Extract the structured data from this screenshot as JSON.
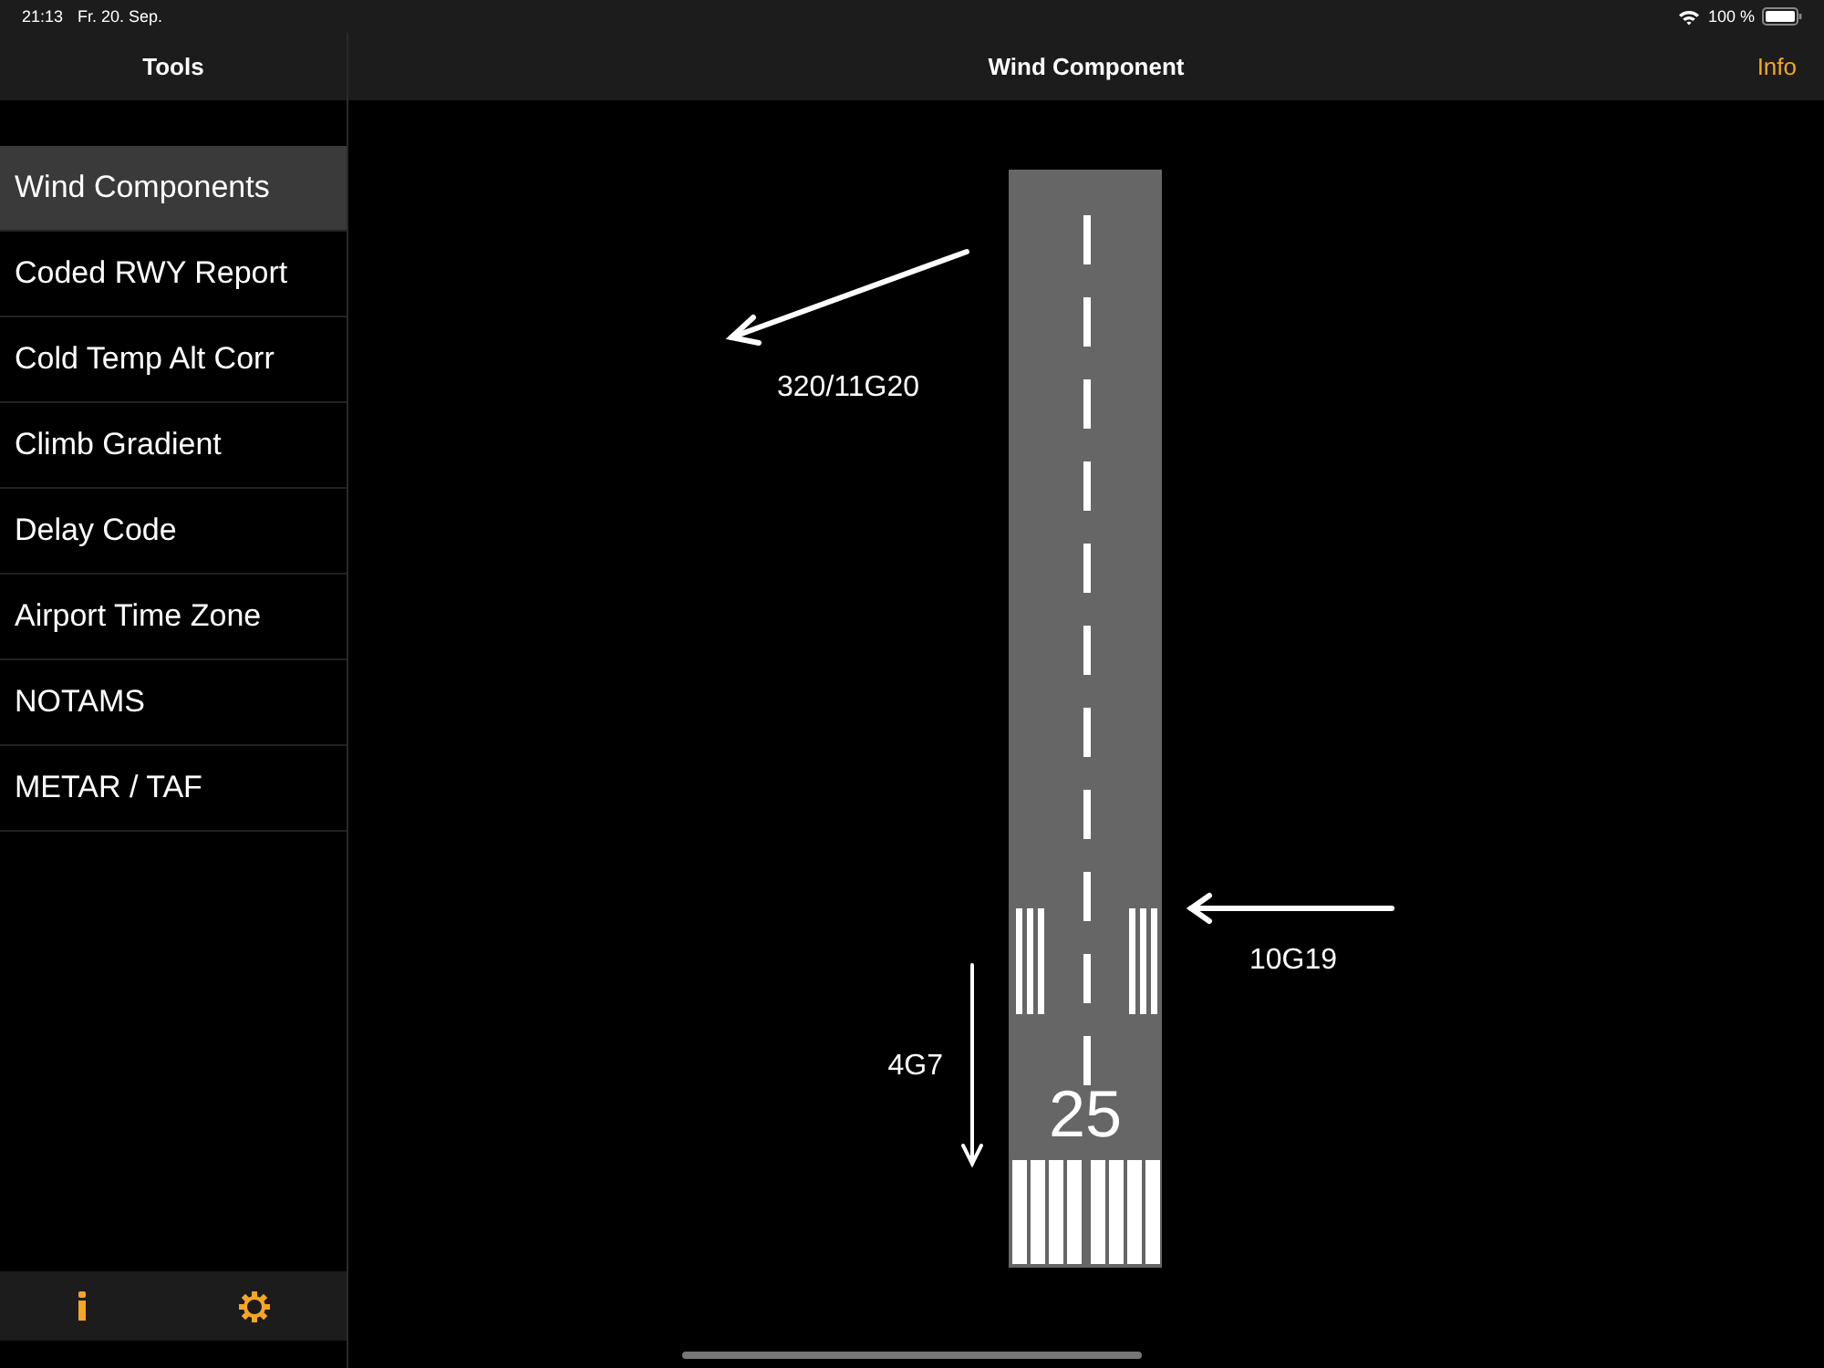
{
  "status_bar": {
    "time": "21:13",
    "date": "Fr. 20. Sep.",
    "battery": "100 %"
  },
  "sidebar": {
    "title": "Tools",
    "items": [
      {
        "label": "Wind Components",
        "selected": true
      },
      {
        "label": "Coded RWY Report",
        "selected": false
      },
      {
        "label": "Cold Temp Alt Corr",
        "selected": false
      },
      {
        "label": "Climb Gradient",
        "selected": false
      },
      {
        "label": "Delay Code",
        "selected": false
      },
      {
        "label": "Airport Time Zone",
        "selected": false
      },
      {
        "label": "NOTAMS",
        "selected": false
      },
      {
        "label": "METAR / TAF",
        "selected": false
      }
    ]
  },
  "detail": {
    "title": "Wind Component",
    "info_button": "Info",
    "diagram": {
      "runway_number": "25",
      "wind_label": "320/11G20",
      "crosswind_label": "10G19",
      "headwind_label": "4G7"
    }
  }
}
